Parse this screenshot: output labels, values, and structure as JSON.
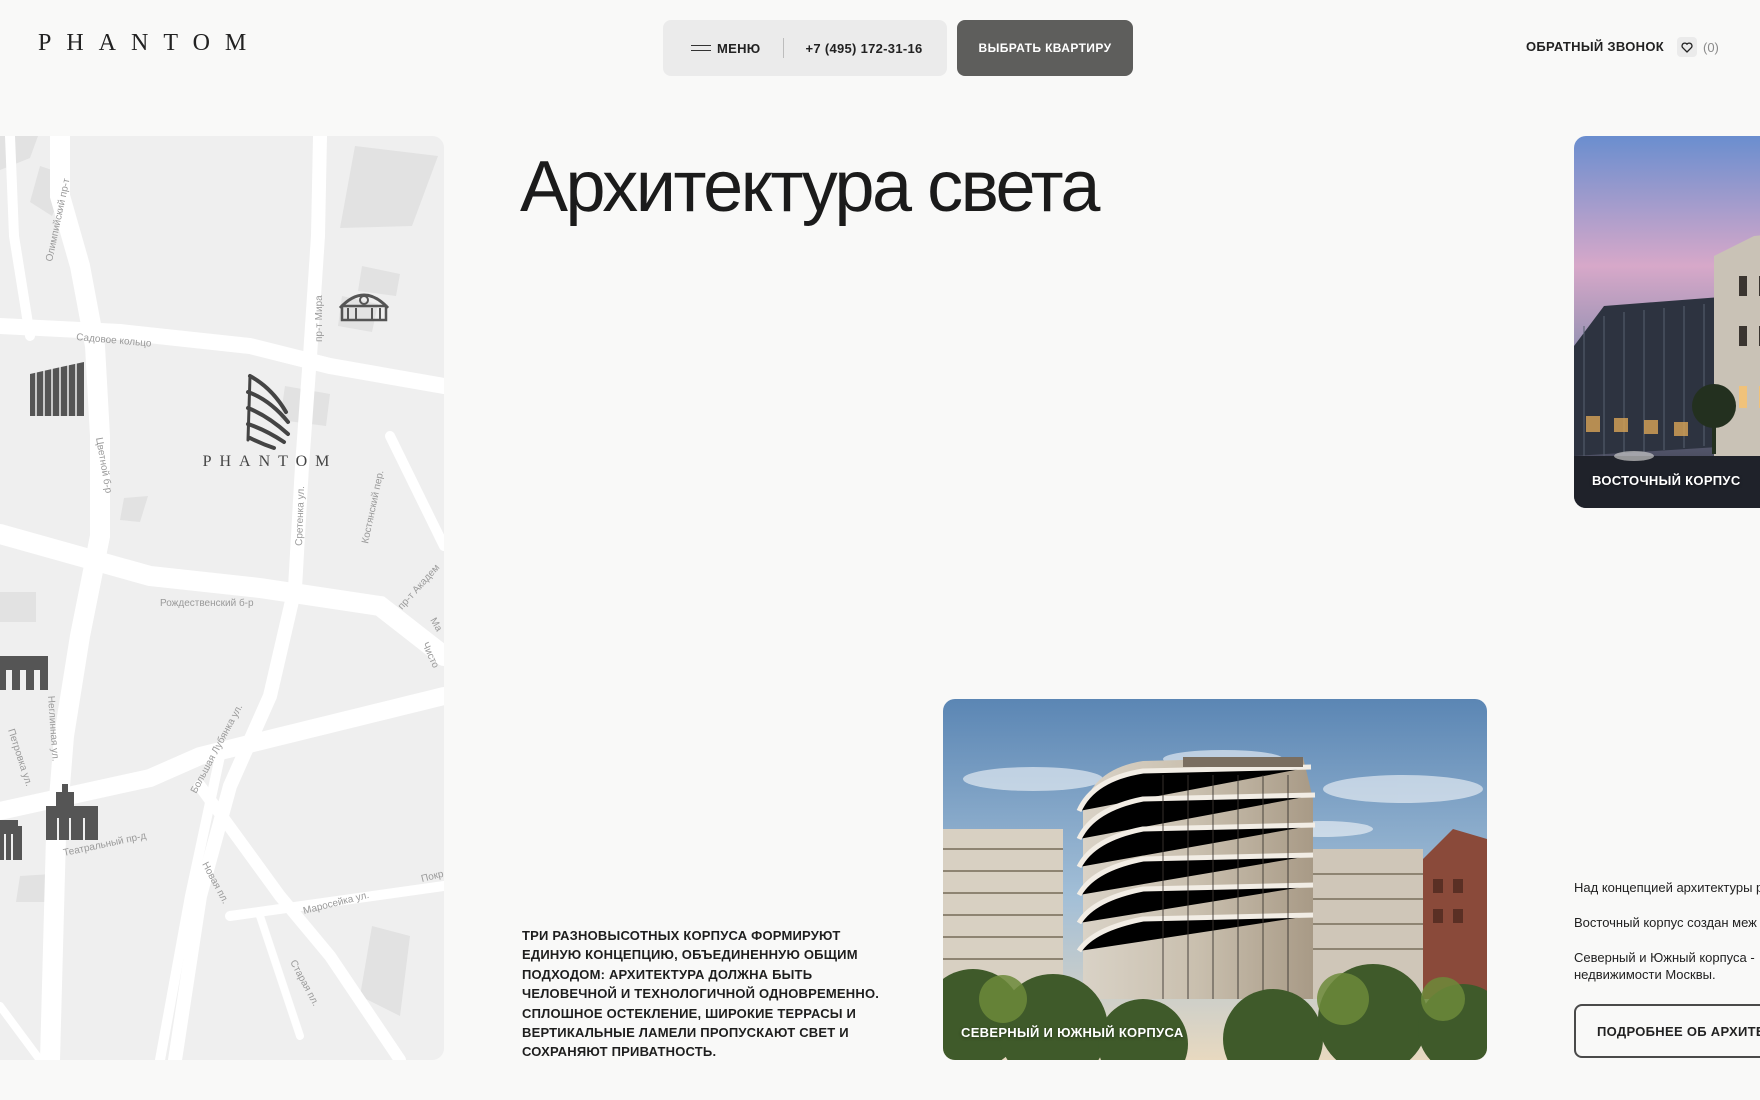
{
  "header": {
    "logo": "PHANTOM",
    "menu_label": "МЕНЮ",
    "phone": "+7 (495) 172-31-16",
    "choose_label": "ВЫБРАТЬ КВАРТИРУ",
    "callback_label": "ОБРАТНЫЙ ЗВОНОК",
    "favorites_count": "(0)"
  },
  "map": {
    "logo": "PHANTOM",
    "streets": {
      "olimp": "Олимпийский пр-т",
      "sadovoe": "Садовое кольцо",
      "mira": "пр-т Мира",
      "tsvetnoy": "Цветной б-р",
      "sretenka": "Сретенка ул.",
      "kostyansky": "Костянский пер.",
      "rozhd": "Рождественский б-р",
      "akadem": "пр-т Академ",
      "ma": "Ма",
      "chist": "Чисто",
      "neglin": "Неглинная ул.",
      "petrovka": "Петровка ул.",
      "lubyanka": "Большая Лубянка ул.",
      "teatr": "Театральный пр-д",
      "novaya": "Новая пл.",
      "maroseyka": "Маросейка ул.",
      "pokr": "Покр",
      "staraya": "Старая пл."
    }
  },
  "main": {
    "title": "Архитектура света",
    "description": "Три разновысотных корпуса формируют единую концепцию, объединенную общим подходом: архитектура должна быть человечной и технологичной одновременно. Сплошное остекление, широкие террасы и вертикальные ламели пропускают свет и сохраняют приватность.",
    "card_main_label": "СЕВЕРНЫЙ И ЮЖНЫЙ КОРПУСА",
    "card_east_label": "ВОСТОЧНЫЙ КОРПУС"
  },
  "right_column": {
    "line1": "Над концепцией архитектуры р",
    "line2": "Восточный корпус создан меж",
    "line3a": "Северный и Южный корпуса -",
    "line3b": "недвижимости Москвы.",
    "more_button": "ПОДРОБНЕЕ ОБ АРХИТЕК"
  },
  "colors": {
    "background": "#f9f9f8",
    "pill": "#ebebeb",
    "primary_button": "#5e5e5c",
    "map_block": "#efefef",
    "map_road": "#ffffff",
    "map_icon": "#555555"
  }
}
